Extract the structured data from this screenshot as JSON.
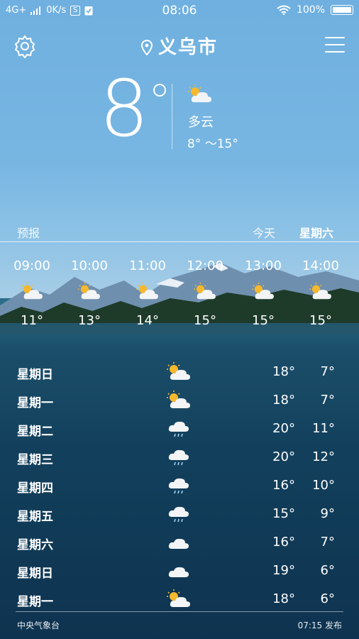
{
  "status_bar": {
    "network": "4G+",
    "speed": "0K/s",
    "time": "08:06",
    "battery": "100%"
  },
  "header": {
    "city": "义乌市"
  },
  "current": {
    "temperature": "8",
    "condition": "多云",
    "range": "8° ～15°",
    "icon": "partly-cloudy-icon"
  },
  "labels": {
    "forecast": "预报",
    "today": "今天",
    "weekday": "星期六"
  },
  "hourly": [
    {
      "time": "09:00",
      "temp": "11°",
      "icon": "partly-cloudy-icon"
    },
    {
      "time": "10:00",
      "temp": "13°",
      "icon": "partly-cloudy-icon"
    },
    {
      "time": "11:00",
      "temp": "14°",
      "icon": "partly-cloudy-icon"
    },
    {
      "time": "12:00",
      "temp": "15°",
      "icon": "partly-cloudy-icon"
    },
    {
      "time": "13:00",
      "temp": "15°",
      "icon": "partly-cloudy-icon"
    },
    {
      "time": "14:00",
      "temp": "15°",
      "icon": "partly-cloudy-icon"
    }
  ],
  "daily": [
    {
      "day": "星期日",
      "icon": "partly-cloudy-icon",
      "high": "18°",
      "low": "7°"
    },
    {
      "day": "星期一",
      "icon": "partly-cloudy-icon",
      "high": "18°",
      "low": "7°"
    },
    {
      "day": "星期二",
      "icon": "rain-icon",
      "high": "20°",
      "low": "11°"
    },
    {
      "day": "星期三",
      "icon": "rain-icon",
      "high": "20°",
      "low": "12°"
    },
    {
      "day": "星期四",
      "icon": "rain-icon",
      "high": "16°",
      "low": "10°"
    },
    {
      "day": "星期五",
      "icon": "rain-icon",
      "high": "15°",
      "low": "9°"
    },
    {
      "day": "星期六",
      "icon": "cloud-icon",
      "high": "16°",
      "low": "7°"
    },
    {
      "day": "星期日",
      "icon": "cloud-icon",
      "high": "19°",
      "low": "6°"
    },
    {
      "day": "星期一",
      "icon": "partly-cloudy-icon",
      "high": "18°",
      "low": "6°"
    }
  ],
  "footer": {
    "source": "中央气象台",
    "published": "07:15 发布"
  }
}
